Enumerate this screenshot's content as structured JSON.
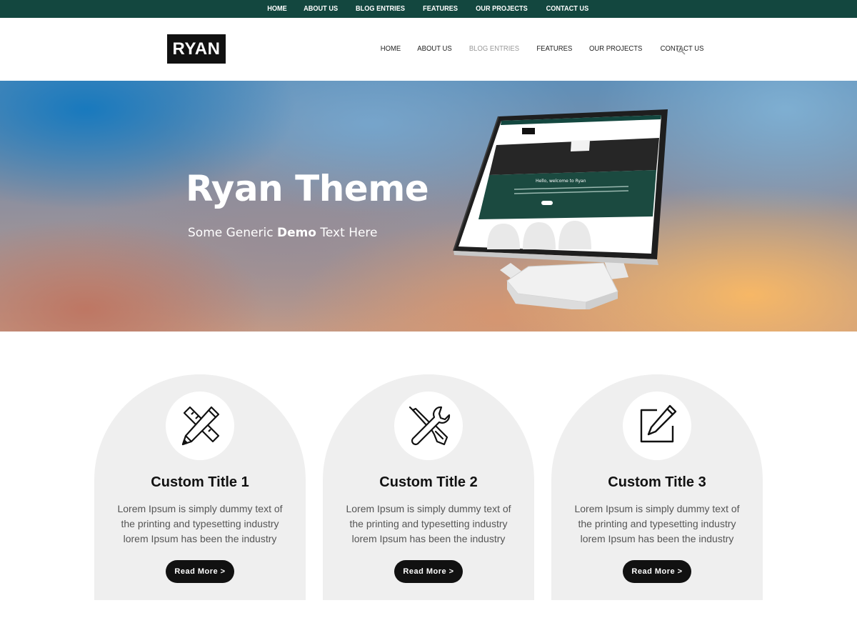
{
  "topbar": {
    "items": [
      "HOME",
      "ABOUT US",
      "BLOG ENTRIES",
      "FEATURES",
      "OUR PROJECTS",
      "CONTACT US"
    ]
  },
  "header": {
    "logo": "RYAN",
    "nav": [
      "HOME",
      "ABOUT US",
      "BLOG ENTRIES",
      "FEATURES",
      "OUR PROJECTS",
      "CONTACT US"
    ],
    "active_item": "BLOG ENTRIES",
    "search_icon": "search-icon"
  },
  "hero": {
    "title": "Ryan Theme",
    "subtitle_pre": "Some Generic ",
    "subtitle_bold": "Demo",
    "subtitle_post": " Text Here"
  },
  "cards": [
    {
      "icon": "pencil-ruler-icon",
      "title": "Custom Title 1",
      "text": "Lorem Ipsum is simply dummy text of the printing and typesetting industry lorem Ipsum has been the industry",
      "button": "Read More >"
    },
    {
      "icon": "screwdriver-wrench-icon",
      "title": "Custom Title 2",
      "text": "Lorem Ipsum is simply dummy text of the printing and typesetting industry lorem Ipsum has been the industry",
      "button": "Read More >"
    },
    {
      "icon": "edit-square-icon",
      "title": "Custom Title 3",
      "text": "Lorem Ipsum is simply dummy text of the printing and typesetting industry lorem Ipsum has been the industry",
      "button": "Read More >"
    }
  ],
  "colors": {
    "topbar_bg": "#13473f",
    "logo_bg": "#111111",
    "card_bg": "#efefef",
    "button_bg": "#111111",
    "nav_active": "#999999"
  }
}
